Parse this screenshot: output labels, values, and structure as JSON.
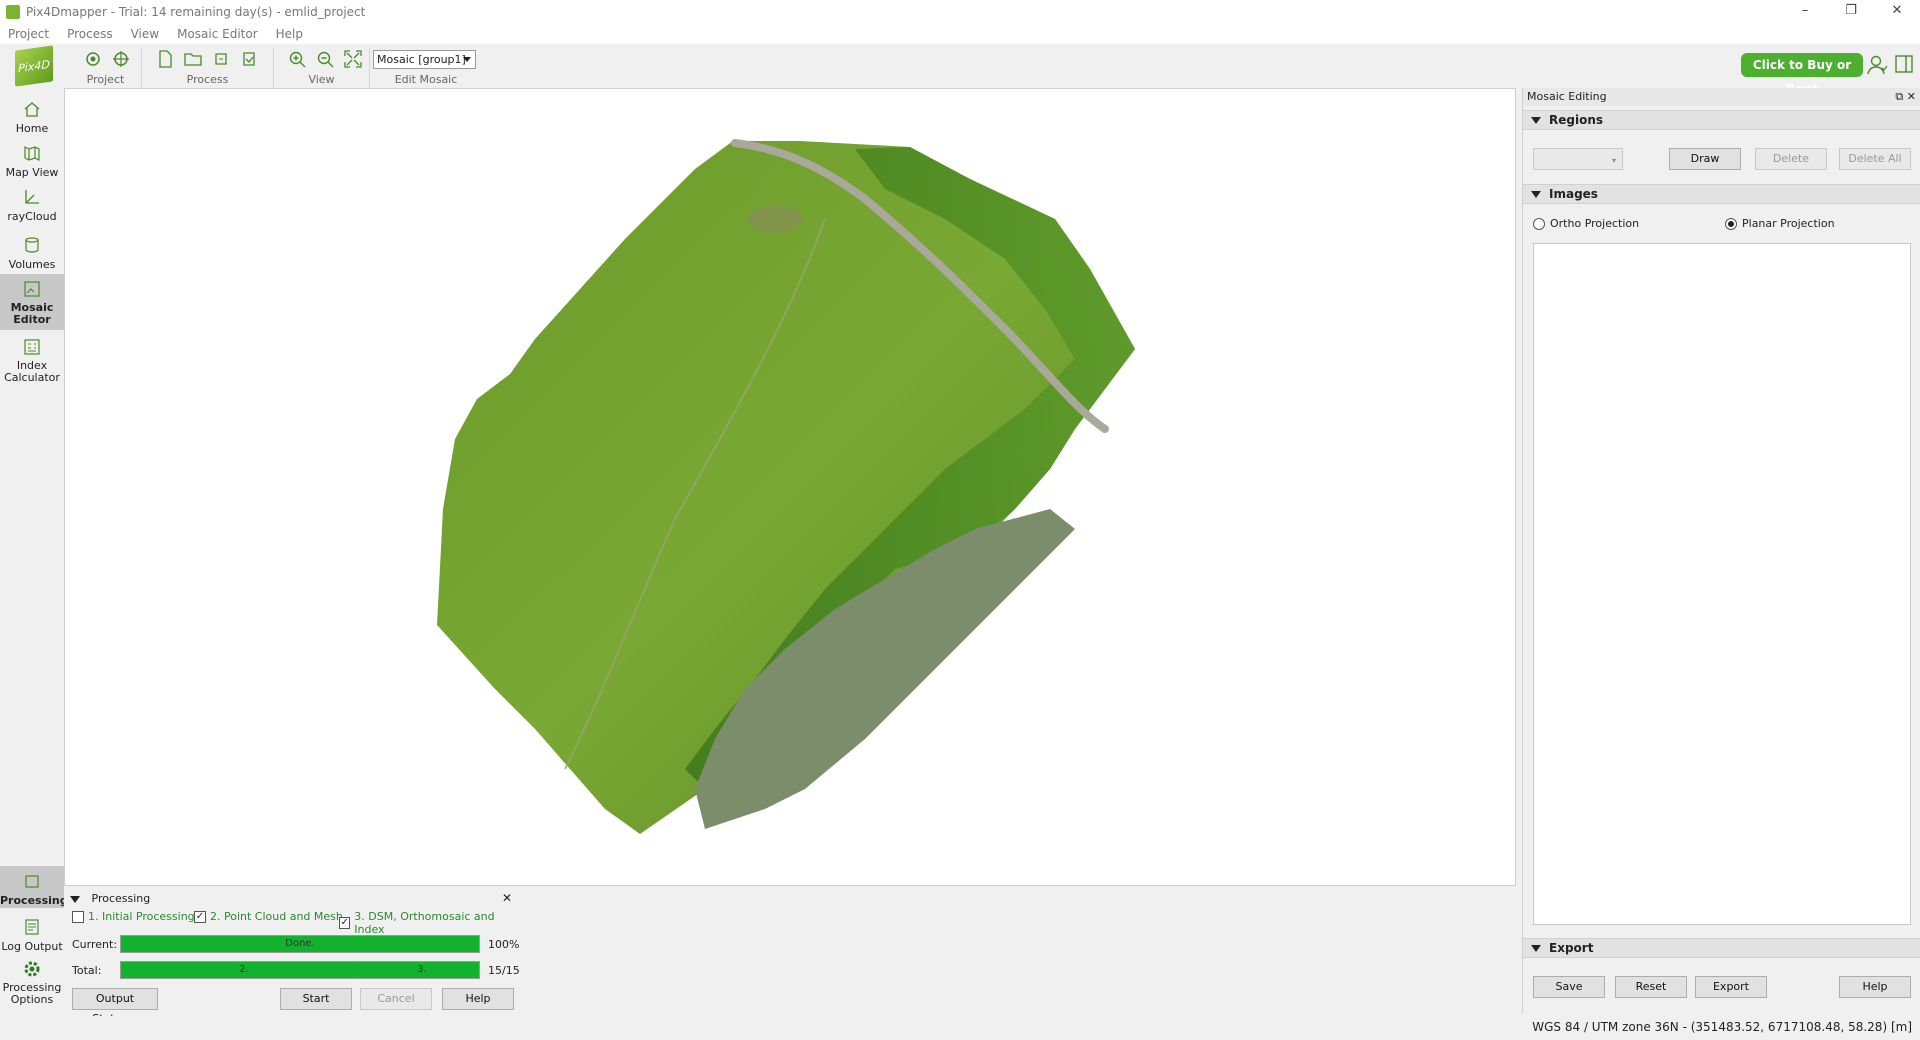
{
  "window": {
    "title": "Pix4Dmapper - Trial: 14 remaining day(s) - emlid_project",
    "controls": [
      "–",
      "❐",
      "✕"
    ]
  },
  "menu": [
    "Project",
    "Process",
    "View",
    "Mosaic Editor",
    "Help"
  ],
  "toolbar": {
    "logo_text": "Pix4D",
    "groups": {
      "project": "Project",
      "process": "Process",
      "view": "View",
      "edit_mosaic": "Edit Mosaic"
    },
    "mosaic_select": "Mosaic [group1]",
    "buy_button": "Click to Buy or Rent"
  },
  "sidebar": {
    "items": [
      {
        "label": "Home",
        "icon": "home-icon"
      },
      {
        "label": "Map View",
        "icon": "map-icon"
      },
      {
        "label": "rayCloud",
        "icon": "raycloud-icon"
      },
      {
        "label": "Volumes",
        "icon": "volumes-icon"
      },
      {
        "label": "Mosaic Editor",
        "icon": "mosaic-editor-icon"
      },
      {
        "label": "Index Calculator",
        "icon": "index-calculator-icon"
      }
    ],
    "bottom_items": [
      {
        "label": "Processing",
        "icon": "processing-icon"
      },
      {
        "label": "Log Output",
        "icon": "log-output-icon"
      },
      {
        "label": "Processing Options",
        "icon": "gear-icon"
      }
    ]
  },
  "right_panel": {
    "title": "Mosaic Editing",
    "regions": {
      "title": "Regions",
      "draw": "Draw",
      "delete": "Delete",
      "delete_all": "Delete All"
    },
    "images": {
      "title": "Images",
      "ortho": "Ortho Projection",
      "planar": "Planar Projection",
      "selected": "planar"
    },
    "export": {
      "title": "Export",
      "save": "Save",
      "reset": "Reset",
      "export": "Export",
      "help": "Help"
    }
  },
  "processing": {
    "title": "Processing",
    "steps": [
      {
        "label": "1. Initial Processing",
        "checked": false
      },
      {
        "label": "2. Point Cloud and Mesh",
        "checked": true
      },
      {
        "label": "3. DSM, Orthomosaic and Index",
        "checked": true
      }
    ],
    "current_label": "Current:",
    "current_text": "Done.",
    "current_value": "100%",
    "current_progress": 1.0,
    "total_label": "Total:",
    "total_marks": [
      "2.",
      "3."
    ],
    "total_value": "15/15",
    "total_progress": 1.0,
    "buttons": {
      "output_status": "Output Status...",
      "start": "Start",
      "cancel": "Cancel",
      "help": "Help"
    }
  },
  "status": {
    "coords": "WGS 84 / UTM zone 36N - (351483.52, 6717108.48, 58.28) [m]"
  },
  "colors": {
    "accent_green": "#4caf2f",
    "progress_green": "#12b12e",
    "field_green": "#6a9b2e",
    "lake": "#7c8d6c"
  }
}
